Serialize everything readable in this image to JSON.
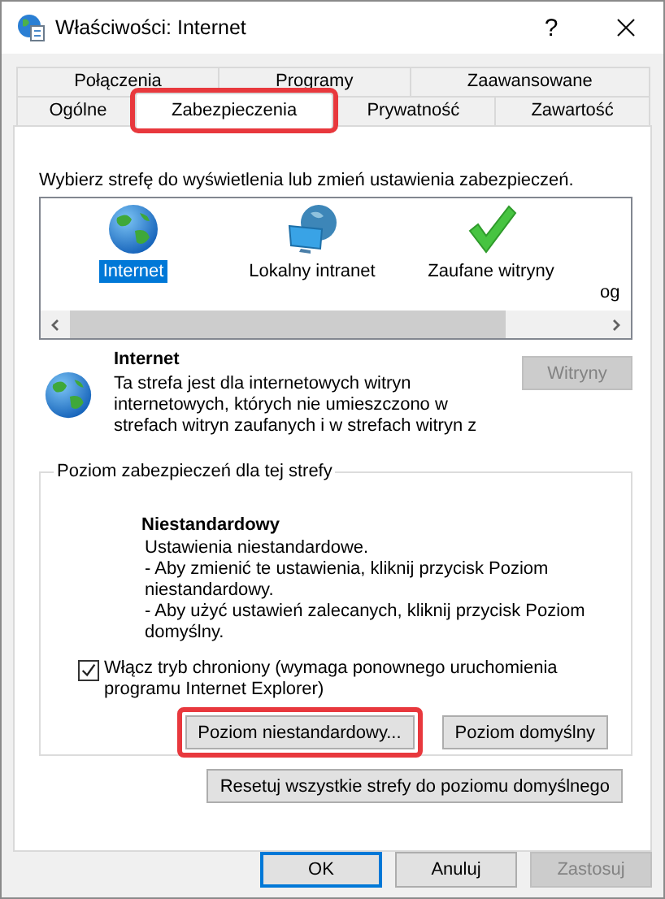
{
  "window": {
    "title": "Właściwości: Internet",
    "help": "?"
  },
  "tab_rows": [
    [
      {
        "label": "Połączenia",
        "selected": false,
        "highlighted": false
      },
      {
        "label": "Programy",
        "selected": false,
        "highlighted": false
      },
      {
        "label": "Zaawansowane",
        "selected": false,
        "highlighted": false
      }
    ],
    [
      {
        "label": "Ogólne",
        "selected": false,
        "highlighted": false
      },
      {
        "label": "Zabezpieczenia",
        "selected": true,
        "highlighted": true
      },
      {
        "label": "Prywatność",
        "selected": false,
        "highlighted": false
      },
      {
        "label": "Zawartość",
        "selected": false,
        "highlighted": false
      }
    ]
  ],
  "instruction": "Wybierz strefę do wyświetlenia lub zmień ustawienia zabezpieczeń.",
  "zones": [
    {
      "kind": "globe",
      "label": "Internet",
      "selected": true
    },
    {
      "kind": "intranet",
      "label": "Lokalny intranet",
      "selected": false
    },
    {
      "kind": "check",
      "label": "Zaufane witryny",
      "selected": false
    },
    {
      "kind": "partial",
      "label": "og",
      "selected": false
    }
  ],
  "zone_info": {
    "title": "Internet",
    "description": "Ta strefa jest dla internetowych witryn\ninternetowych, których nie umieszczono w\nstrefach witryn zaufanych i w strefach witryn z",
    "button": {
      "label": "Witryny",
      "disabled": true
    }
  },
  "level_group": {
    "legend": "Poziom zabezpieczeń dla tej strefy",
    "level_title": "Niestandardowy",
    "level_description": "Ustawienia niestandardowe.\n- Aby zmienić te ustawienia, kliknij przycisk Poziom\nniestandardowy.\n- Aby użyć ustawień zalecanych, kliknij przycisk Poziom\ndomyślny.",
    "protected_mode": {
      "label": "Włącz tryb chroniony (wymaga ponownego uruchomienia\nprogramu Internet Explorer)",
      "checked": true
    },
    "buttons": [
      {
        "label": "Poziom niestandardowy...",
        "highlighted": true
      },
      {
        "label": "Poziom domyślny",
        "highlighted": false
      }
    ]
  },
  "reset_button": "Resetuj wszystkie strefy do poziomu domyślnego",
  "dialog_buttons": [
    {
      "label": "OK",
      "default": true,
      "disabled": false
    },
    {
      "label": "Anuluj",
      "default": false,
      "disabled": false
    },
    {
      "label": "Zastosuj",
      "default": false,
      "disabled": true
    }
  ]
}
